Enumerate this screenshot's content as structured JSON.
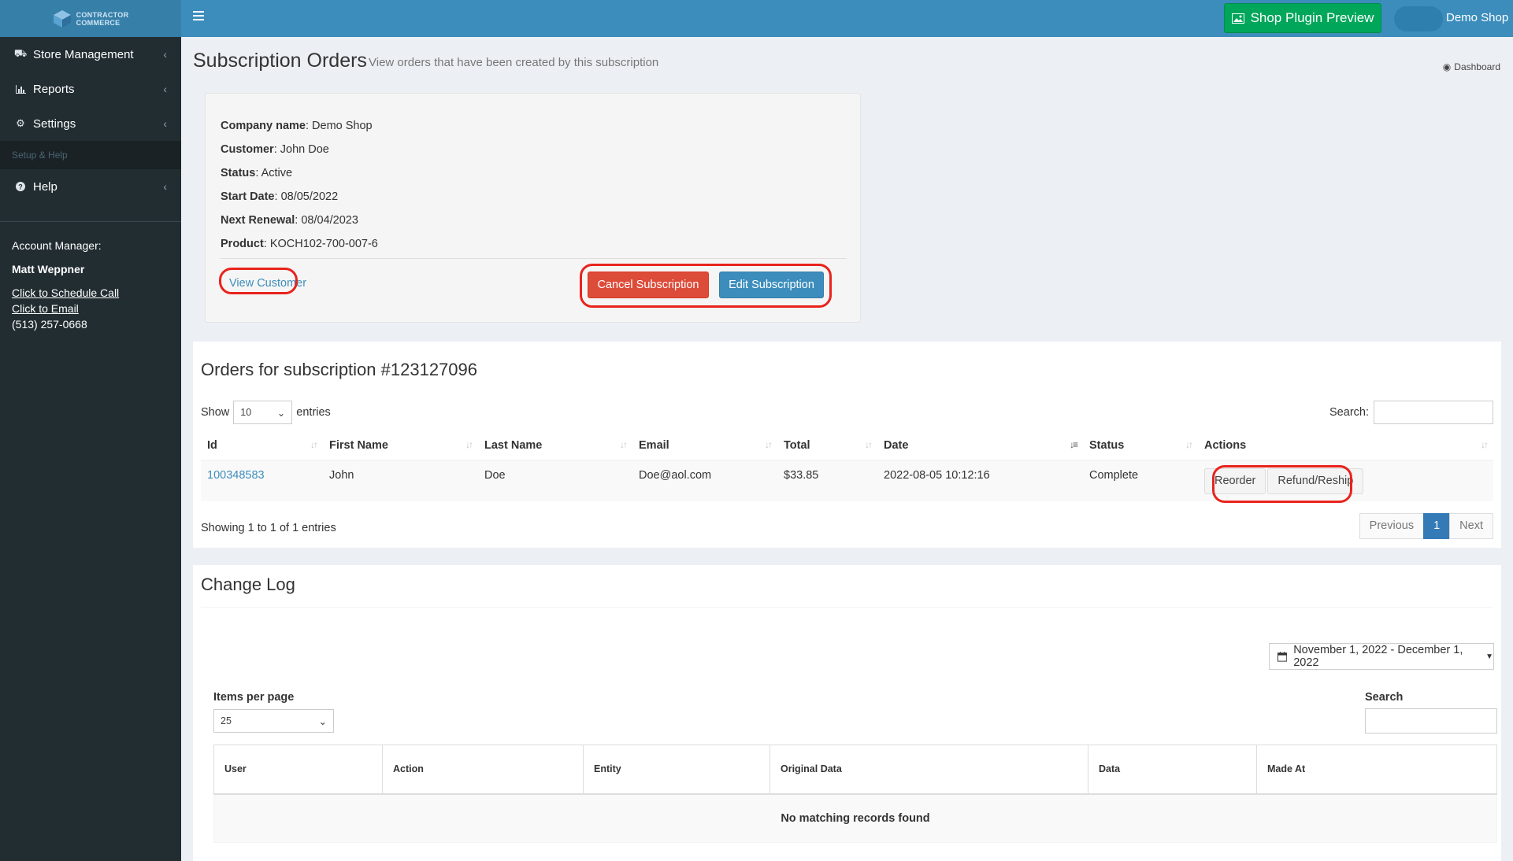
{
  "brand": {
    "line1": "CONTRACTOR",
    "line2": "COMMERCE"
  },
  "sidebar": {
    "items": [
      {
        "label": "Store Management",
        "icon": "truck-icon"
      },
      {
        "label": "Reports",
        "icon": "bar-chart-icon"
      },
      {
        "label": "Settings",
        "icon": "gear-icon"
      }
    ],
    "section_header": "Setup & Help",
    "help": {
      "label": "Help",
      "icon": "question-circle-icon"
    },
    "account": {
      "title": "Account Manager:",
      "name": "Matt Weppner",
      "schedule": "Click to Schedule Call",
      "email": "Click to Email",
      "phone": "(513) 257-0668"
    }
  },
  "topbar": {
    "preview_label": "Shop Plugin Preview",
    "user_name": "Demo Shop"
  },
  "page": {
    "title": "Subscription Orders",
    "subtitle": "View orders that have been created by this subscription",
    "breadcrumb": "Dashboard"
  },
  "subscription": {
    "company_label": "Company name",
    "company": "Demo Shop",
    "customer_label": "Customer",
    "customer": "John Doe",
    "status_label": "Status",
    "status": "Active",
    "start_label": "Start Date",
    "start": "08/05/2022",
    "renewal_label": "Next Renewal",
    "renewal": "08/04/2023",
    "product_label": "Product",
    "product": "KOCH102-700-007-6",
    "view_customer": "View Customer",
    "cancel": "Cancel Subscription",
    "edit": "Edit Subscription"
  },
  "orders": {
    "title": "Orders for subscription #123127096",
    "show": "Show",
    "entries": "entries",
    "page_size": "10",
    "search_label": "Search:",
    "columns": [
      "Id",
      "First Name",
      "Last Name",
      "Email",
      "Total",
      "Date",
      "Status",
      "Actions"
    ],
    "rows": [
      {
        "id": "100348583",
        "first": "John",
        "last": "Doe",
        "email": "Doe@aol.com",
        "total": "$33.85",
        "date": "2022-08-05 10:12:16",
        "status": "Complete",
        "reorder": "Reorder",
        "refund": "Refund/Reship"
      }
    ],
    "showing": "Showing 1 to 1 of 1 entries",
    "pager": {
      "prev": "Previous",
      "page": "1",
      "next": "Next"
    }
  },
  "changelog": {
    "title": "Change Log",
    "date_range": "November 1, 2022 - December 1, 2022",
    "items_per_page_label": "Items per page",
    "items_per_page": "25",
    "search_label": "Search",
    "columns": [
      "User",
      "Action",
      "Entity",
      "Original Data",
      "Data",
      "Made At"
    ],
    "empty": "No matching records found"
  },
  "colors": {
    "sidebar": "#222d32",
    "topbar": "#3c8dbc",
    "success": "#00a65a",
    "danger": "#dd4b39",
    "highlight": "#e8231c"
  }
}
